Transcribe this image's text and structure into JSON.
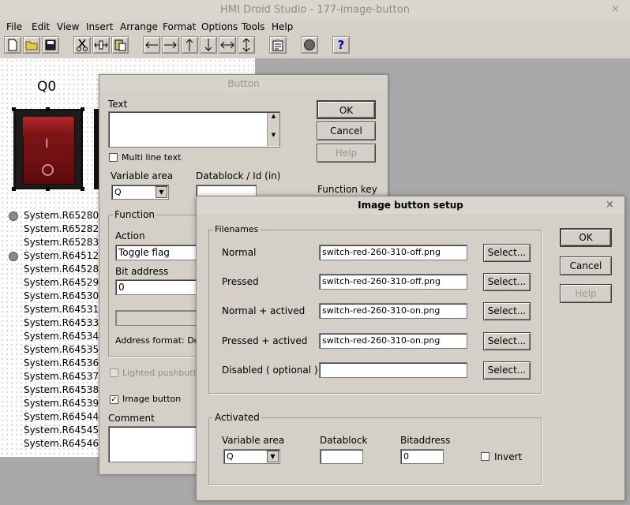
{
  "window": {
    "title": "HMI Droid Studio - 177-image-button",
    "close_glyph": "×"
  },
  "menu": [
    {
      "label": "File"
    },
    {
      "label": "Edit"
    },
    {
      "label": "View"
    },
    {
      "label": "Insert"
    },
    {
      "label": "Arrange"
    },
    {
      "label": "Format"
    },
    {
      "label": "Options"
    },
    {
      "label": "Tools"
    },
    {
      "label": "Help"
    }
  ],
  "toolbar_icons": [
    "new-file-icon",
    "open-folder-icon",
    "save-icon",
    "cut-icon",
    "align-icon",
    "paste-icon",
    "arrow-left-icon",
    "arrow-right-icon",
    "arrow-up-icon",
    "arrow-down-icon",
    "resize-horizontal-icon",
    "resize-vertical-icon",
    "properties-icon",
    "circle-icon",
    "help-icon"
  ],
  "canvas": {
    "label_q0": "Q0",
    "switch_glyph": "I",
    "system_rows": [
      {
        "text": "System.R65280:",
        "led": true
      },
      {
        "text": "System.R65282:",
        "led": false
      },
      {
        "text": "System.R65283:",
        "led": false
      },
      {
        "text": "System.R64512:",
        "led": true
      },
      {
        "text": "System.R64528:",
        "led": false
      },
      {
        "text": "System.R64529:",
        "led": false
      },
      {
        "text": "System.R64530:",
        "led": false
      },
      {
        "text": "System.R64531:",
        "led": false
      },
      {
        "text": "System.R64533:",
        "led": false
      },
      {
        "text": "System.R64534:",
        "led": false
      },
      {
        "text": "System.R64535:",
        "led": false
      },
      {
        "text": "System.R64536:",
        "led": false
      },
      {
        "text": "System.R64537:",
        "led": false
      },
      {
        "text": "System.R64538:",
        "led": false
      },
      {
        "text": "System.R64539:",
        "led": false
      },
      {
        "text": "System.R64544:",
        "led": false
      },
      {
        "text": "System.R64545:",
        "led": false
      },
      {
        "text": "System.R64546:",
        "led": false
      }
    ]
  },
  "button_dialog": {
    "title": "Button",
    "text_label": "Text",
    "text_value": "",
    "multiline_label": "Multi line text",
    "multiline_checked": false,
    "variable_area_label": "Variable area",
    "variable_area_value": "Q",
    "datablock_label": "Datablock / Id (in)",
    "datablock_value": "",
    "function_key_label": "Function key",
    "function_group": "Function",
    "action_label": "Action",
    "action_value": "Toggle flag",
    "bit_address_label": "Bit address",
    "bit_address_value": "0",
    "address_format": "Address format: Defau",
    "lighted_label": "Lighted pushbutton",
    "lighted_checked": false,
    "image_button_label": "Image button",
    "image_button_checked": true,
    "comment_label": "Comment",
    "comment_value": "",
    "ok": "OK",
    "cancel": "Cancel",
    "help": "Help",
    "check_mark": "✓"
  },
  "image_dialog": {
    "title": "Image button setup",
    "close_glyph": "×",
    "filenames_group": "Filenames",
    "rows": [
      {
        "label": "Normal",
        "value": "switch-red-260-310-off.png",
        "select": "Select..."
      },
      {
        "label": "Pressed",
        "value": "switch-red-260-310-off.png",
        "select": "Select..."
      },
      {
        "label": "Normal + actived",
        "value": "switch-red-260-310-on.png",
        "select": "Select..."
      },
      {
        "label": "Pressed + actived",
        "value": "switch-red-260-310-on.png",
        "select": "Select..."
      },
      {
        "label": "Disabled ( optional )",
        "value": "",
        "select": "Select..."
      }
    ],
    "activated_group": "Activated",
    "variable_area_label": "Variable area",
    "variable_area_value": "Q",
    "datablock_label": "Datablock",
    "datablock_value": "",
    "bitaddress_label": "Bitaddress",
    "bitaddress_value": "0",
    "invert_label": "Invert",
    "invert_checked": false,
    "ok": "OK",
    "cancel": "Cancel",
    "help": "Help"
  },
  "colors": {
    "dialog_bg": "#d4d0c8",
    "switch_red": "#7a0e10",
    "workspace": "#a9a9a9"
  }
}
